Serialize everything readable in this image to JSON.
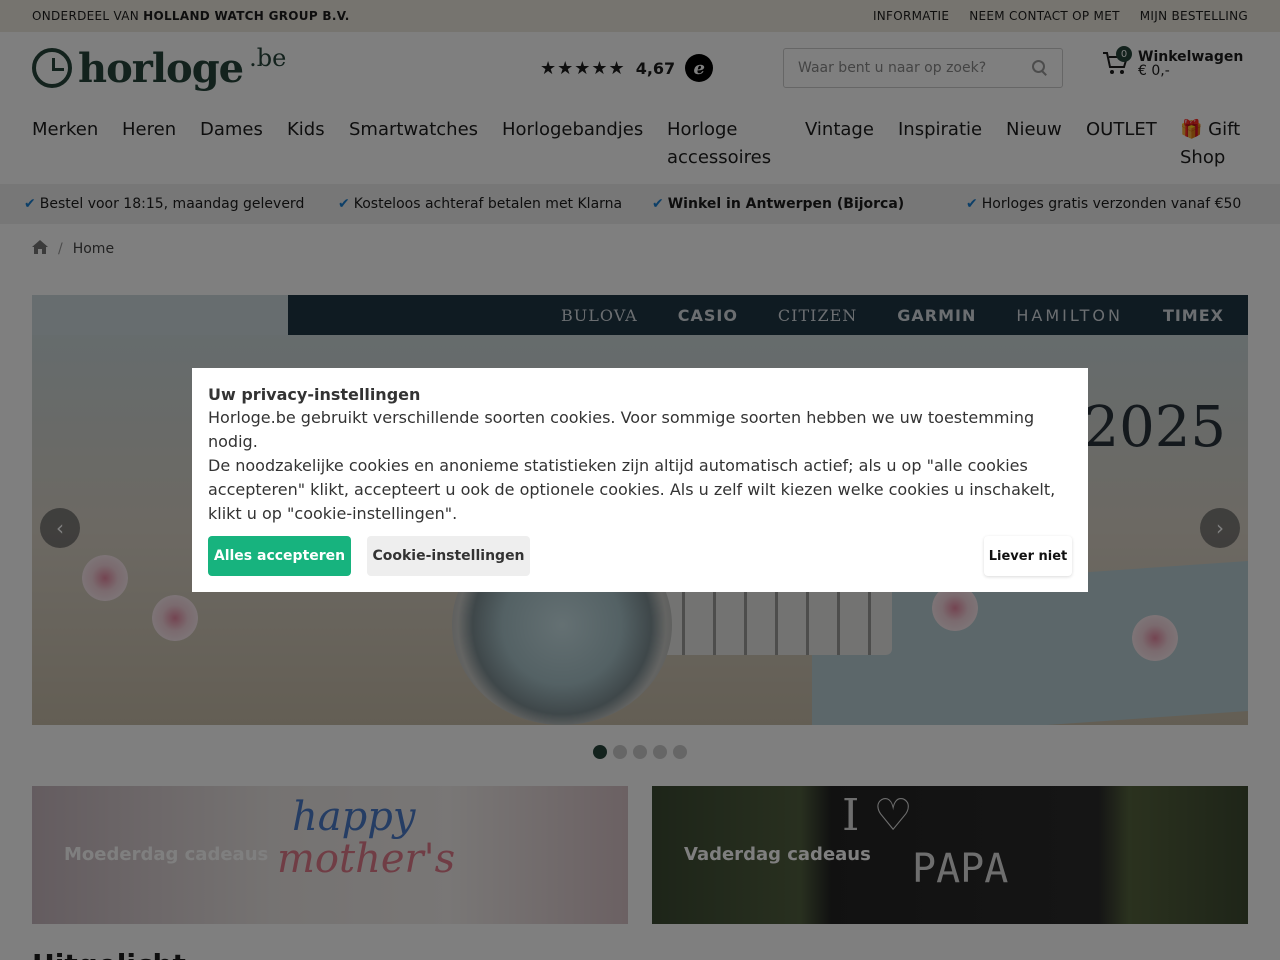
{
  "topbar": {
    "prefix": "ONDERDEEL VAN",
    "company": "HOLLAND WATCH GROUP B.V.",
    "links": [
      "INFORMATIE",
      "NEEM CONTACT OP MET",
      "MIJN BESTELLING"
    ]
  },
  "header": {
    "logo_word": "horloge",
    "logo_tld": ".be",
    "rating_stars": "★★★★★",
    "rating_value": "4,67",
    "rating_badge": "e",
    "search_placeholder": "Waar bent u naar op zoek?",
    "cart_count": "0",
    "cart_label": "Winkelwagen",
    "cart_total": "€ 0,-"
  },
  "nav": [
    "Merken",
    "Heren",
    "Dames",
    "Kids",
    "Smartwatches",
    "Horlogebandjes",
    "Horloge accessoires",
    "Vintage",
    "Inspiratie",
    "Nieuw",
    "OUTLET",
    "🎁 Gift Shop"
  ],
  "usp": [
    "Bestel voor 18:15, maandag geleverd",
    "Kosteloos achteraf betalen met Klarna",
    "Winkel in Antwerpen (Bijorca)",
    "Horloges gratis verzonden vanaf €50"
  ],
  "breadcrumb": {
    "separator": "/",
    "current": "Home"
  },
  "hero": {
    "brands": [
      "BULOVA",
      "CASIO",
      "CITIZEN",
      "GARMIN",
      "HAMILTON",
      "TIMEX"
    ],
    "year": "2025",
    "prev": "‹",
    "next": "›",
    "slides": 5,
    "active_slide": 1
  },
  "tiles": {
    "moeder": "Moederdag cadeaus",
    "vader": "Vaderdag cadeaus",
    "moeder_art_1": "happy",
    "moeder_art_2": "mother's",
    "vader_art_1": "I ♡",
    "vader_art_2": "PAPA"
  },
  "section_title": "Uitgelicht",
  "cookie": {
    "title": "Uw privacy-instellingen",
    "line1": "Horloge.be gebruikt verschillende soorten cookies. Voor sommige soorten hebben we uw toestemming nodig.",
    "line2": "De noodzakelijke cookies en anonieme statistieken zijn altijd automatisch actief; als u op \"alle cookies accepteren\" klikt, accepteert u ook de optionele cookies. Als u zelf wilt kiezen welke cookies u inschakelt, klikt u op \"cookie-instellingen\".",
    "accept": "Alles accepteren",
    "settings": "Cookie-instellingen",
    "decline": "Liever niet"
  },
  "colors": {
    "brand": "#26453b",
    "accept": "#17b37e",
    "check": "#1b7fd1",
    "brands_bar": "#1f3644"
  }
}
